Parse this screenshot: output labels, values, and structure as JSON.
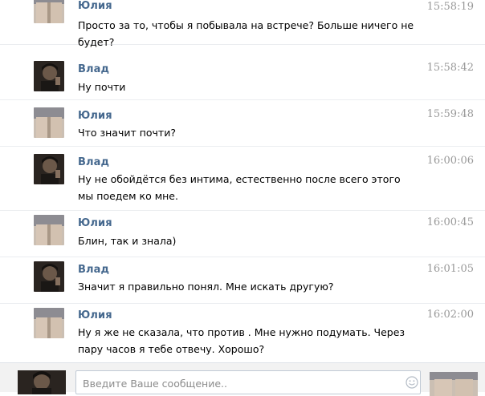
{
  "messages": [
    {
      "author": "Юлия",
      "time": "15:58:19",
      "avatar": "girl-legs-photo",
      "text": "Просто за то, чтобы я побывала на встрече? Больше ничего не будет?"
    },
    {
      "author": "Влад",
      "time": "15:58:42",
      "avatar": "guy-photo",
      "text": "Ну почти"
    },
    {
      "author": "Юлия",
      "time": "15:59:48",
      "avatar": "girl-legs-photo",
      "text": "Что значит почти?"
    },
    {
      "author": "Влад",
      "time": "16:00:06",
      "avatar": "guy-photo",
      "text": "Ну не обойдётся без интима, естественно после всего этого мы поедем ко мне."
    },
    {
      "author": "Юлия",
      "time": "16:00:45",
      "avatar": "girl-legs-photo",
      "text": "Блин, так и знала)"
    },
    {
      "author": "Влад",
      "time": "16:01:05",
      "avatar": "guy-photo",
      "text": "Значит я правильно понял. Мне искать другую?"
    },
    {
      "author": "Юлия",
      "time": "16:02:00",
      "avatar": "girl-legs-photo",
      "text": "Ну я же не сказала, что против . Мне нужно подумать. Через пару часов я тебе отвечу. Хорошо?"
    }
  ],
  "composer": {
    "placeholder": "Введите Ваше сообщение..",
    "smile_icon": "smile-icon"
  },
  "colors": {
    "author": "#45688e",
    "time": "#999999",
    "divider": "#ebedf0"
  }
}
